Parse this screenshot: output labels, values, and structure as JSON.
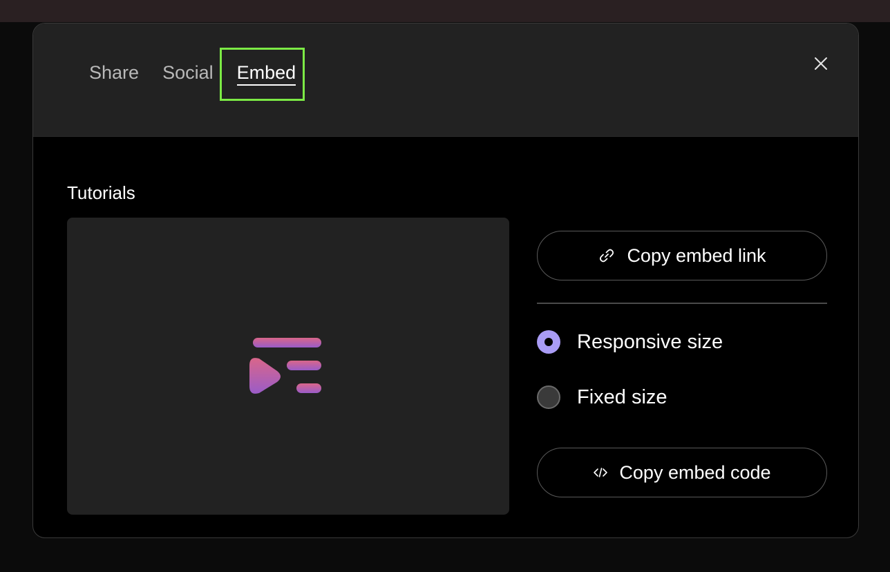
{
  "tabs": [
    {
      "label": "Share",
      "active": false
    },
    {
      "label": "Social",
      "active": false
    },
    {
      "label": "Embed",
      "active": true
    }
  ],
  "close_icon": "close-icon",
  "section": {
    "title": "Tutorials"
  },
  "preview": {
    "logo_icon": "playlist-play-icon",
    "logo_colors": [
      "#d9668a",
      "#9a5cc8"
    ]
  },
  "actions": {
    "copy_link_label": "Copy embed link",
    "copy_link_icon": "link-icon",
    "copy_code_label": "Copy embed code",
    "copy_code_icon": "code-icon"
  },
  "size_options": [
    {
      "label": "Responsive size",
      "selected": true
    },
    {
      "label": "Fixed size",
      "selected": false
    }
  ],
  "colors": {
    "accent": "#a99cf5",
    "highlight": "#7cea45",
    "header_bg": "#222222",
    "body_bg": "#000000"
  }
}
